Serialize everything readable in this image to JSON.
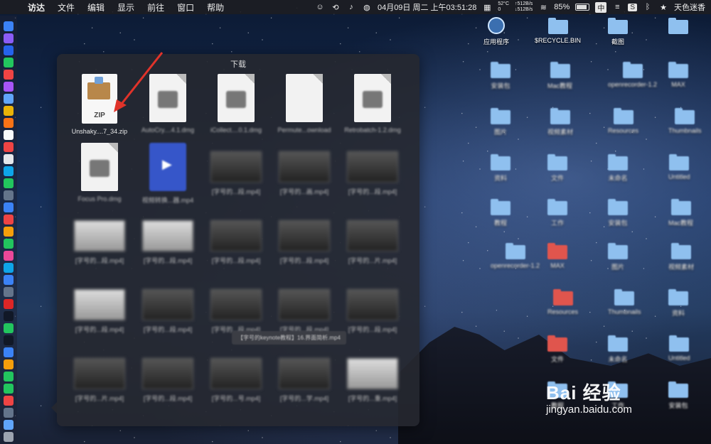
{
  "menubar": {
    "app_name": "访达",
    "menus": [
      "文件",
      "编辑",
      "显示",
      "前往",
      "窗口",
      "帮助"
    ],
    "datetime": "04月09日 周二 上午03:51:28",
    "temperature": "52°C",
    "cpu": "0",
    "net_up": "↑512B/s",
    "net_down": "↓512B/s",
    "battery": "85%",
    "battery_level": 0.85,
    "input_method": "中",
    "username": "天色迷香"
  },
  "stack": {
    "title": "下载",
    "items": [
      {
        "label": "Unshaky....7_34.zip",
        "kind": "zip",
        "icon_text": "ZIP"
      },
      {
        "label": "AutoCry....4.1.dmg",
        "kind": "dmg"
      },
      {
        "label": "iCollect....0.1.dmg",
        "kind": "dmg"
      },
      {
        "label": "Permute...ownload",
        "kind": "doc"
      },
      {
        "label": "Retrobatch-1.2.dmg",
        "kind": "dmg"
      },
      {
        "label": "Focus Pro.dmg",
        "kind": "dmg"
      },
      {
        "label": "视频转换...器.mp4",
        "kind": "blue"
      },
      {
        "label": "[字号的...段.mp4]",
        "kind": "video"
      },
      {
        "label": "[字号的...画.mp4]",
        "kind": "video"
      },
      {
        "label": "[字号的...段.mp4]",
        "kind": "video"
      },
      {
        "label": "[字号的...段.mp4]",
        "kind": "video-light"
      },
      {
        "label": "[字号的...段.mp4]",
        "kind": "video-light"
      },
      {
        "label": "[字号的...段.mp4]",
        "kind": "video"
      },
      {
        "label": "[字号的...段.mp4]",
        "kind": "video"
      },
      {
        "label": "[字号的...片.mp4]",
        "kind": "video"
      },
      {
        "label": "[字号的...段.mp4]",
        "kind": "video-light"
      },
      {
        "label": "[字号的...段.mp4]",
        "kind": "video"
      },
      {
        "label": "[字号的...段.mp4]",
        "kind": "video"
      },
      {
        "label": "[字号的...段.mp4]",
        "kind": "video"
      },
      {
        "label": "[字号的...段.mp4]",
        "kind": "video"
      },
      {
        "label": "[字号的...片.mp4]",
        "kind": "video"
      },
      {
        "label": "[字号的...段.mp4]",
        "kind": "video"
      },
      {
        "label": "[字号的...号.mp4]",
        "kind": "video"
      },
      {
        "label": "[字号的...学.mp4]",
        "kind": "video"
      },
      {
        "label": "[字号的...重.mp4]",
        "kind": "video-light"
      }
    ],
    "tooltip": "【字号的keynote教程】16.界面简析.mp4"
  },
  "desktop": {
    "apps_label": "应用程序",
    "recycle_label": "$RECYCLE.BIN",
    "screenshot_label": "截图",
    "blurred_labels": [
      "安装包",
      "Mac教程",
      "openrecorder-1.2",
      "MAX",
      "图片",
      "视频素材",
      "Resources",
      "Thumbnails",
      "资料",
      "文件",
      "未命名",
      "Untitled",
      "教程",
      "工作"
    ]
  },
  "watermark": {
    "brand": "Bai 经验",
    "url": "jingyan.baidu.com"
  }
}
